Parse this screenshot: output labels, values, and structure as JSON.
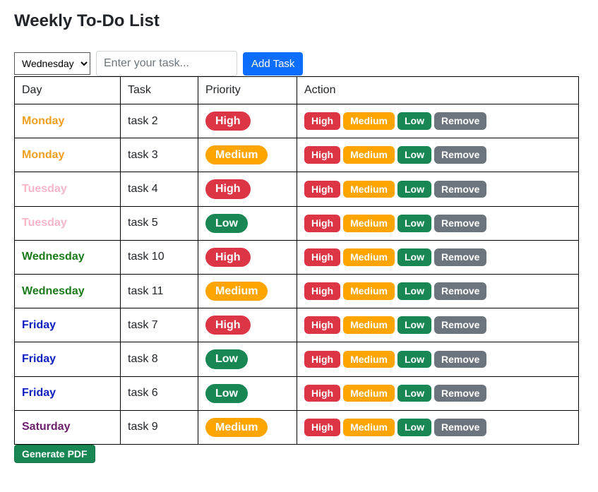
{
  "page_title": "Weekly To-Do List",
  "controls": {
    "day_select_value": "Wednesday",
    "task_input_placeholder": "Enter your task...",
    "add_task_label": "Add Task",
    "generate_pdf_label": "Generate PDF"
  },
  "columns": {
    "day": "Day",
    "task": "Task",
    "priority": "Priority",
    "action": "Action"
  },
  "priority_labels": {
    "high": "High",
    "medium": "Medium",
    "low": "Low"
  },
  "action_labels": {
    "high": "High",
    "medium": "Medium",
    "low": "Low",
    "remove": "Remove"
  },
  "rows": [
    {
      "day": "Monday",
      "day_class": "day-monday",
      "task": "task 2",
      "priority": "High",
      "priority_class": "badge-high"
    },
    {
      "day": "Monday",
      "day_class": "day-monday",
      "task": "task 3",
      "priority": "Medium",
      "priority_class": "badge-medium"
    },
    {
      "day": "Tuesday",
      "day_class": "day-tuesday",
      "task": "task 4",
      "priority": "High",
      "priority_class": "badge-high"
    },
    {
      "day": "Tuesday",
      "day_class": "day-tuesday",
      "task": "task 5",
      "priority": "Low",
      "priority_class": "badge-low"
    },
    {
      "day": "Wednesday",
      "day_class": "day-wednesday",
      "task": "task 10",
      "priority": "High",
      "priority_class": "badge-high"
    },
    {
      "day": "Wednesday",
      "day_class": "day-wednesday",
      "task": "task 11",
      "priority": "Medium",
      "priority_class": "badge-medium"
    },
    {
      "day": "Friday",
      "day_class": "day-friday",
      "task": "task 7",
      "priority": "High",
      "priority_class": "badge-high"
    },
    {
      "day": "Friday",
      "day_class": "day-friday",
      "task": "task 8",
      "priority": "Low",
      "priority_class": "badge-low"
    },
    {
      "day": "Friday",
      "day_class": "day-friday",
      "task": "task 6",
      "priority": "Low",
      "priority_class": "badge-low"
    },
    {
      "day": "Saturday",
      "day_class": "day-saturday",
      "task": "task 9",
      "priority": "Medium",
      "priority_class": "badge-medium"
    }
  ]
}
